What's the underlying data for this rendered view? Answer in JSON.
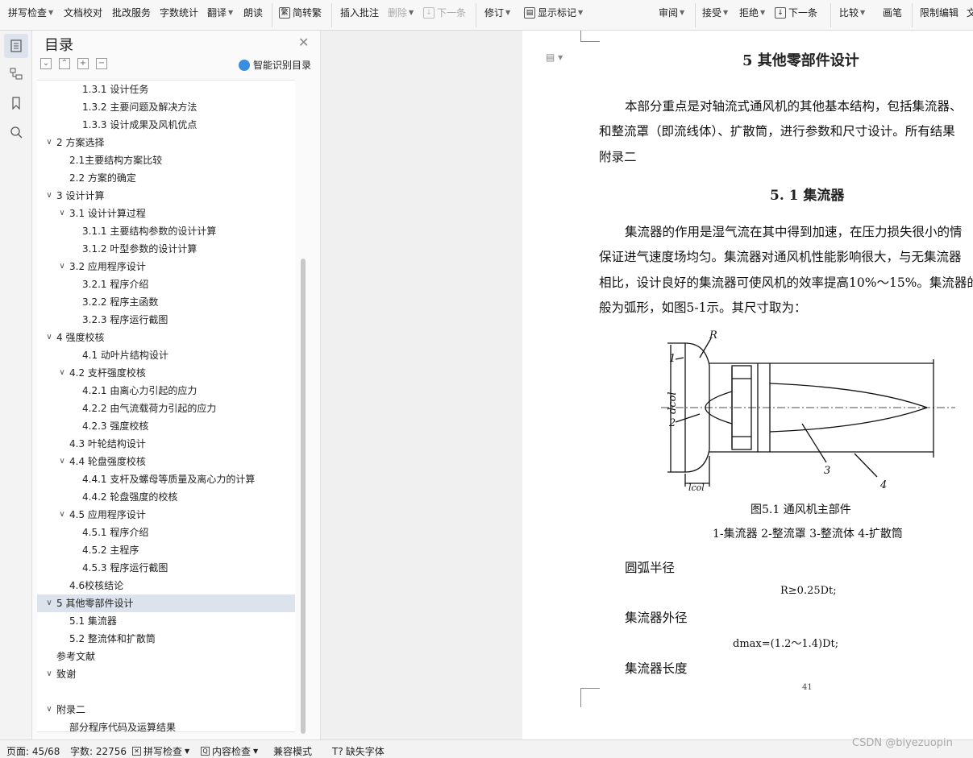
{
  "ribbon": {
    "items": [
      {
        "label": "拼写检查",
        "caret": true
      },
      {
        "label": "文档校对",
        "caret": false
      },
      {
        "label": "批改服务",
        "caret": false
      },
      {
        "label": "字数统计",
        "caret": false
      },
      {
        "label": "翻译",
        "caret": true
      },
      {
        "label": "朗读",
        "caret": false
      },
      {
        "label": "简转繁",
        "caret": false
      },
      {
        "label": "插入批注",
        "caret": false
      },
      {
        "label": "删除",
        "caret": true
      },
      {
        "label": "下一条",
        "caret": false
      },
      {
        "label": "修订",
        "caret": true
      },
      {
        "label": "显示标记",
        "caret": true
      },
      {
        "label": "审阅",
        "caret": true
      },
      {
        "label": "接受",
        "caret": true
      },
      {
        "label": "拒绝",
        "caret": true
      },
      {
        "label": "下一条",
        "caret": false
      },
      {
        "label": "比较",
        "caret": true
      },
      {
        "label": "画笔",
        "caret": false
      },
      {
        "label": "限制编辑",
        "caret": false
      },
      {
        "label": "文",
        "caret": false
      }
    ]
  },
  "rail": {
    "icons": [
      "toc-icon",
      "nav-tree-icon",
      "bookmark-icon",
      "search-icon"
    ]
  },
  "toc": {
    "title": "目录",
    "smart_label": "智能识别目录",
    "tools": [
      "⌄",
      "⌃",
      "+",
      "−"
    ],
    "items": [
      {
        "text": "1.3.1  设计任务",
        "level": 3,
        "arrow": ""
      },
      {
        "text": "1.3.2  主要问题及解决方法",
        "level": 3,
        "arrow": ""
      },
      {
        "text": "1.3.3  设计成果及风机优点",
        "level": 3,
        "arrow": ""
      },
      {
        "text": "2  方案选择",
        "level": 1,
        "arrow": "∨"
      },
      {
        "text": "2.1主要结构方案比较",
        "level": 2,
        "arrow": ""
      },
      {
        "text": "2.2  方案的确定",
        "level": 2,
        "arrow": ""
      },
      {
        "text": "3  设计计算",
        "level": 1,
        "arrow": "∨"
      },
      {
        "text": "3.1  设计计算过程",
        "level": 2,
        "arrow": "∨"
      },
      {
        "text": "3.1.1  主要结构参数的设计计算",
        "level": 3,
        "arrow": ""
      },
      {
        "text": "3.1.2  叶型参数的设计计算",
        "level": 3,
        "arrow": ""
      },
      {
        "text": "3.2  应用程序设计",
        "level": 2,
        "arrow": "∨"
      },
      {
        "text": "3.2.1  程序介绍",
        "level": 3,
        "arrow": ""
      },
      {
        "text": "3.2.2  程序主函数",
        "level": 3,
        "arrow": ""
      },
      {
        "text": "3.2.3  程序运行截图",
        "level": 3,
        "arrow": ""
      },
      {
        "text": " 4 强度校核",
        "level": 1,
        "arrow": "∨"
      },
      {
        "text": "4.1  动叶片结构设计",
        "level": 2.5,
        "arrow": ""
      },
      {
        "text": "4.2  支杆强度校核",
        "level": 2,
        "arrow": "∨"
      },
      {
        "text": "4.2.1  由离心力引起的应力",
        "level": 3,
        "arrow": ""
      },
      {
        "text": "4.2.2  由气流载荷力引起的应力",
        "level": 3,
        "arrow": ""
      },
      {
        "text": "4.2.3  强度校核",
        "level": 3,
        "arrow": ""
      },
      {
        "text": "4.3  叶轮结构设计",
        "level": 2,
        "arrow": ""
      },
      {
        "text": "4.4  轮盘强度校核",
        "level": 2,
        "arrow": "∨"
      },
      {
        "text": "4.4.1  支杆及螺母等质量及离心力的计算",
        "level": 3,
        "arrow": ""
      },
      {
        "text": "4.4.2  轮盘强度的校核",
        "level": 3,
        "arrow": ""
      },
      {
        "text": "4.5  应用程序设计",
        "level": 2,
        "arrow": "∨"
      },
      {
        "text": "4.5.1  程序介绍",
        "level": 3,
        "arrow": ""
      },
      {
        "text": "4.5.2  主程序",
        "level": 3,
        "arrow": ""
      },
      {
        "text": "4.5.3  程序运行截图",
        "level": 3,
        "arrow": ""
      },
      {
        "text": "4.6校核结论",
        "level": 2,
        "arrow": ""
      },
      {
        "text": "5  其他零部件设计",
        "level": 1,
        "arrow": "∨",
        "selected": true
      },
      {
        "text": "5.1  集流器",
        "level": 2,
        "arrow": ""
      },
      {
        "text": "5.2  整流体和扩散筒",
        "level": 2,
        "arrow": ""
      },
      {
        "text": "参考文献",
        "level": 1,
        "arrow": ""
      },
      {
        "text": "致谢",
        "level": 1,
        "arrow": "∨"
      },
      {
        "text": "",
        "level": 1,
        "arrow": ""
      },
      {
        "text": "附录二",
        "level": 1,
        "arrow": "∨"
      },
      {
        "text": "部分程序代码及运算结果",
        "level": 2,
        "arrow": ""
      }
    ]
  },
  "doc": {
    "h1": "5  其他零部件设计",
    "para1": [
      "本部分重点是对轴流式通风机的其他基本结构，包括集流器、",
      "和整流罩（即流线体）、扩散筒，进行参数和尺寸设计。所有结果",
      "附录二"
    ],
    "h2": "5. 1  集流器",
    "para2": [
      "集流器的作用是湿气流在其中得到加速，在压力损失很小的情",
      "保证进气速度场均匀。集流器对通风机性能影响很大，与无集流器",
      "相比，设计良好的集流器可使风机的效率提高10%～15%。集流器的",
      "般为弧形，如图5-1示。其尺寸取为："
    ],
    "figure": {
      "labels": {
        "r": "R",
        "n1": "1",
        "n2": "2",
        "n3": "3",
        "n4": "4",
        "dcol": "dcol",
        "lcol": "lcol"
      },
      "caption": "图5.1 通风机主部件",
      "legend": "1-集流器 2-整流罩 3-整流体 4-扩散筒"
    },
    "l1": "圆弧半径",
    "f1": "R≥0.25Dt;",
    "l2": "集流器外径",
    "f2": "dmax=(1.2～1.4)Dt;",
    "l3": "集流器长度",
    "page_no": "41"
  },
  "status": {
    "page": "页面: 45/68",
    "words": "字数: 22756",
    "spell": "拼写检查",
    "content": "内容检查",
    "compat": "兼容模式",
    "font": "缺失字体"
  },
  "watermark": "CSDN @biyezuopin"
}
